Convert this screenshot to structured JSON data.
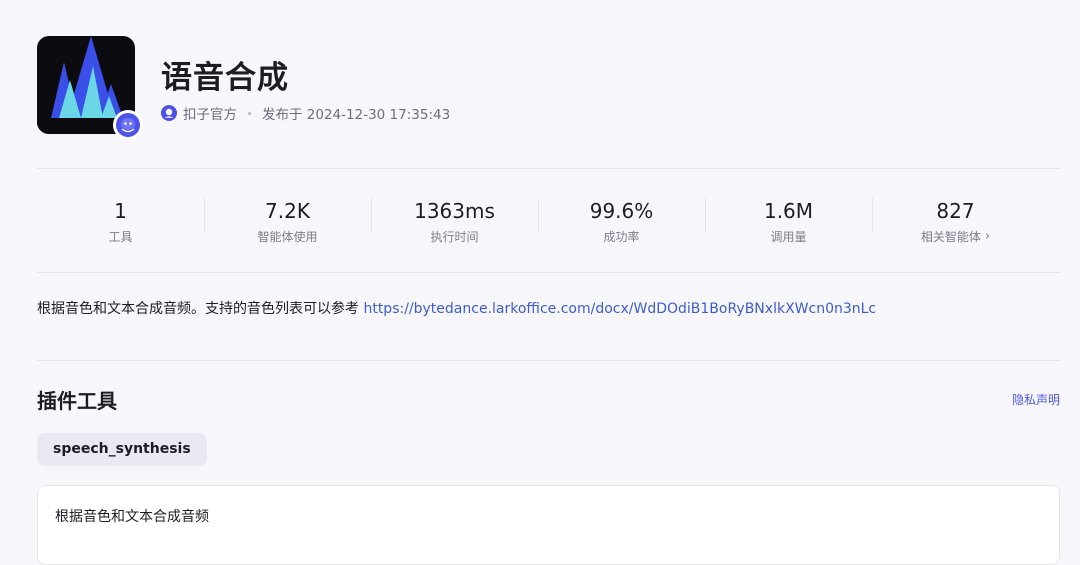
{
  "plugin": {
    "title": "语音合成",
    "author": "扣子官方",
    "published": "发布于 2024-12-30 17:35:43",
    "description_text": "根据音色和文本合成音频。支持的音色列表可以参考 ",
    "description_link": "https://bytedance.larkoffice.com/docx/WdDOdiB1BoRyBNxlkXWcn0n3nLc"
  },
  "stats": [
    {
      "value": "1",
      "label": "工具"
    },
    {
      "value": "7.2K",
      "label": "智能体使用"
    },
    {
      "value": "1363ms",
      "label": "执行时间"
    },
    {
      "value": "99.6%",
      "label": "成功率"
    },
    {
      "value": "1.6M",
      "label": "调用量"
    },
    {
      "value": "827",
      "label": "相关智能体"
    }
  ],
  "tools_section": {
    "title": "插件工具",
    "privacy_label": "隐私声明",
    "tool_name": "speech_synthesis",
    "tool_description": "根据音色和文本合成音频"
  },
  "icons": {
    "logo": "sound-wave-mountain-icon",
    "badge": "coze-mascot-icon",
    "author": "coze-official-icon",
    "chevron": "chevron-right-icon"
  },
  "colors": {
    "accent_link": "#3d5ccc",
    "privacy_link": "#4b57d6",
    "background": "#f7f7fb"
  }
}
